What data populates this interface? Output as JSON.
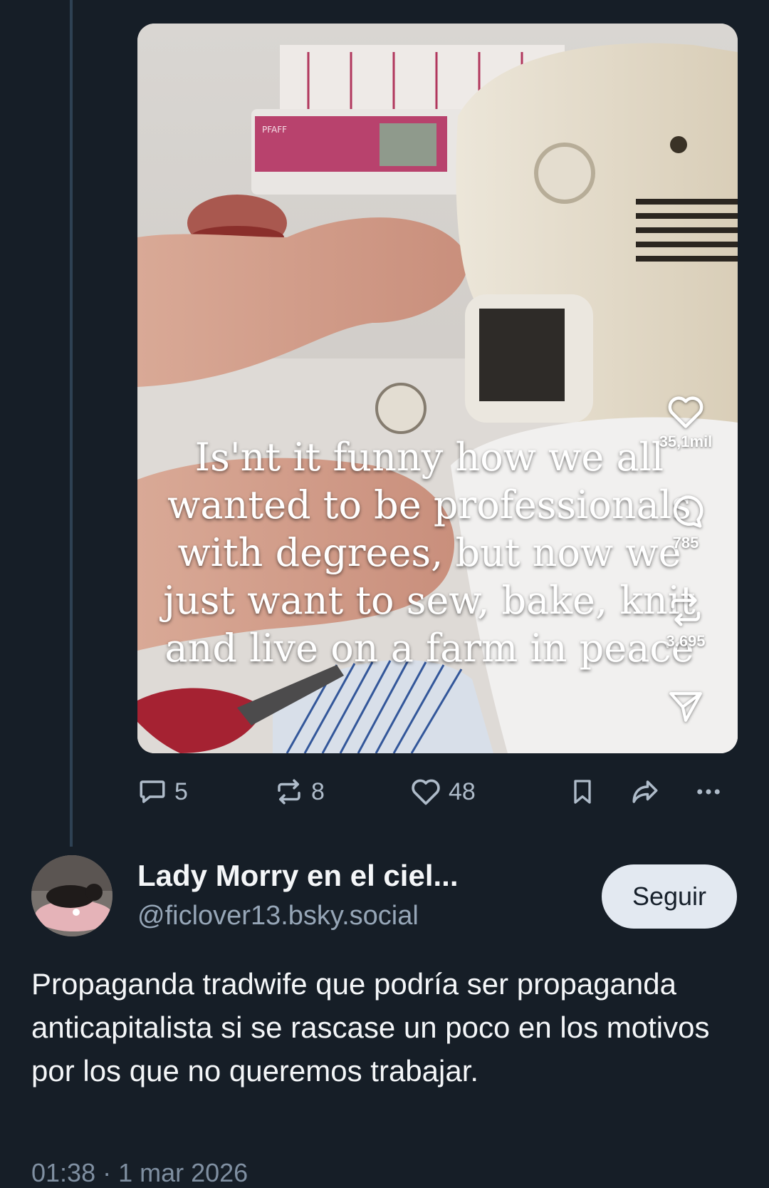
{
  "video": {
    "caption": "Is'nt it funny how we all wanted to be professionals with degrees, but now we just want to sew, bake, knit and live on a farm in peace",
    "machine_brand": "PFAFF",
    "overlay": {
      "likes": "35,1mil",
      "comments": "785",
      "reposts": "3.695"
    }
  },
  "post_actions": {
    "replies": "5",
    "reposts": "8",
    "likes": "48"
  },
  "reply": {
    "author_name": "Lady Morry en el ciel...",
    "handle": "@ficlover13.bsky.social",
    "follow_label": "Seguir",
    "text": "Propaganda tradwife que podría ser propaganda anticapitalista si se rascase un poco en los motivos por los que no queremos trabajar.",
    "timestamp": "01:38 · 1 mar 2026"
  },
  "colors": {
    "background": "#161e27",
    "thread_line": "#2e4153",
    "action_icon": "#aebbc9",
    "handle": "#96a6b7",
    "follow_button": "#e3e9f1"
  },
  "icons": [
    "reply-icon",
    "repost-icon",
    "heart-icon",
    "bookmark-icon",
    "share-icon",
    "more-icon",
    "tt-heart-icon",
    "tt-comment-icon",
    "tt-repost-icon",
    "tt-send-icon"
  ]
}
